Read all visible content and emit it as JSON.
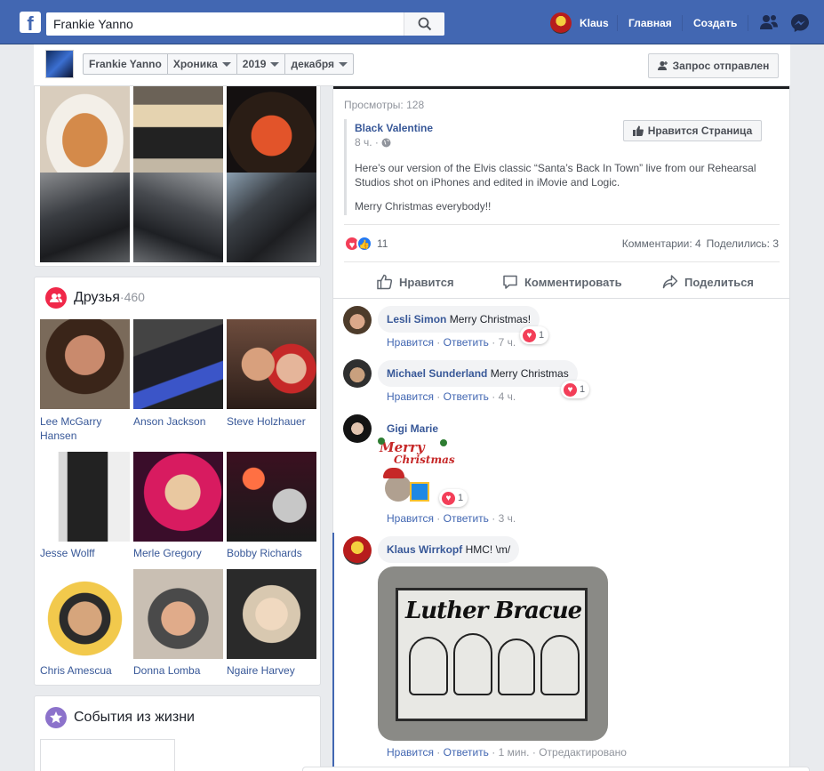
{
  "topbar": {
    "logo": "f",
    "search_value": "Frankie Yanno",
    "search_icon": "search-icon",
    "user_name": "Klaus",
    "home_label": "Главная",
    "create_label": "Создать",
    "friends_icon": "friend-requests-icon",
    "messenger_icon": "messenger-icon",
    "brand_color": "#4267b2"
  },
  "cover_bar": {
    "crumbs": [
      "Frankie Yanno",
      "Хроника",
      "2019",
      "декабря"
    ],
    "request_button": "Запрос отправлен"
  },
  "friends": {
    "title": "Друзья",
    "separator": "·",
    "count": "460",
    "items": [
      {
        "name": "Lee McGarry Hansen"
      },
      {
        "name": "Anson Jackson"
      },
      {
        "name": "Steve Holzhauer"
      },
      {
        "name": "Jesse Wolff"
      },
      {
        "name": "Merle Gregory"
      },
      {
        "name": "Bobby Richards"
      },
      {
        "name": "Chris Amescua"
      },
      {
        "name": "Donna Lomba"
      },
      {
        "name": "Ngaire Harvey"
      }
    ]
  },
  "events": {
    "title": "События из жизни"
  },
  "post": {
    "views": "Просмотры: 128",
    "page_name": "Black Valentine",
    "time": "8 ч. ·",
    "like_page_button": "Нравится Страница",
    "text": "Here’s our version of the Elvis classic “Santa’s Back In Town” live from our Rehearsal Studios shot on iPhones and edited in iMovie and Logic.",
    "text2": "Merry Christmas everybody!!",
    "reactions_count": "11",
    "comments_count": "Комментарии: 4",
    "shares_count": "Поделились: 3",
    "actions": {
      "like": "Нравится",
      "comment": "Комментировать",
      "share": "Поделиться"
    }
  },
  "comments": [
    {
      "name": "Lesli Simon",
      "text": "Merry Christmas!",
      "like": "Нравится",
      "reply": "Ответить",
      "time": "7 ч.",
      "reactions": "1"
    },
    {
      "name": "Michael Sunderland",
      "text": "Merry Christmas",
      "like": "Нравится",
      "reply": "Ответить",
      "time": "4 ч.",
      "reactions": "1"
    },
    {
      "name": "Gigi Marie",
      "text": "",
      "sticker_line1": "Merry",
      "sticker_line2": "Christmas",
      "like": "Нравится",
      "reply": "Ответить",
      "time": "3 ч.",
      "reactions": "1"
    },
    {
      "name": "Klaus Wirrkopf",
      "text": "HMC! \\m/",
      "image_text": "Luther Bracue",
      "like": "Нравится",
      "reply": "Ответить",
      "time": "1 мин.",
      "edited": "Отредактировано"
    }
  ]
}
